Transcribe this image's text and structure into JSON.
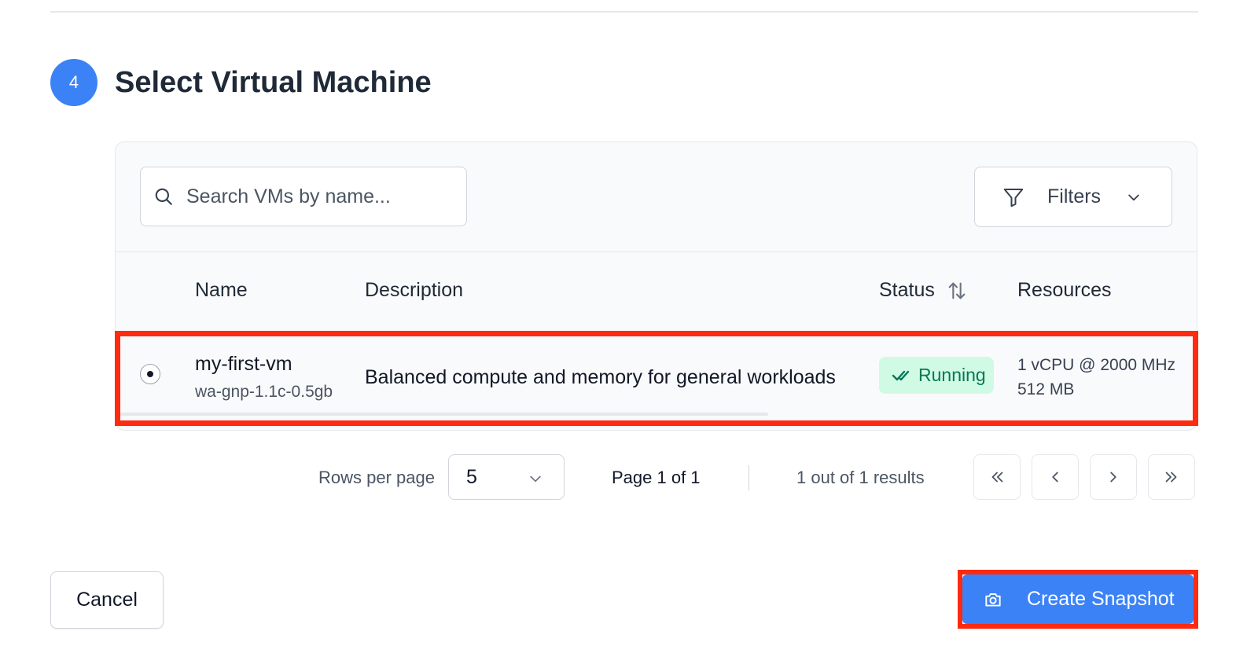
{
  "step": {
    "number": "4",
    "title": "Select Virtual Machine"
  },
  "toolbar": {
    "search_placeholder": "Search VMs by name...",
    "search_value": "",
    "filters_label": "Filters"
  },
  "table": {
    "columns": [
      "Name",
      "Description",
      "Status",
      "Resources"
    ],
    "rows": [
      {
        "selected": true,
        "name": "my-first-vm",
        "plan": "wa-gnp-1.1c-0.5gb",
        "description": "Balanced compute and memory for general workloads",
        "status": "Running",
        "cpu": "1 vCPU @ 2000 MHz",
        "memory": "512 MB"
      }
    ]
  },
  "pagination": {
    "rows_per_page_label": "Rows per page",
    "rows_per_page_value": "5",
    "page_label": "Page 1 of 1",
    "results_label": "1 out of 1 results"
  },
  "actions": {
    "cancel_label": "Cancel",
    "create_label": "Create Snapshot"
  },
  "colors": {
    "primary": "#3b82f6",
    "status_running_bg": "#d1fae5",
    "status_running_text": "#047857",
    "highlight": "#ff2a10"
  },
  "icons": {
    "search": "search-icon",
    "filters": "filter-icon",
    "dropdown": "chevron-down-icon",
    "sort": "sort-icon",
    "status": "double-check-icon",
    "first_page": "chevrons-left-icon",
    "prev_page": "chevron-left-icon",
    "next_page": "chevron-right-icon",
    "last_page": "chevrons-right-icon",
    "snapshot": "camera-icon"
  }
}
